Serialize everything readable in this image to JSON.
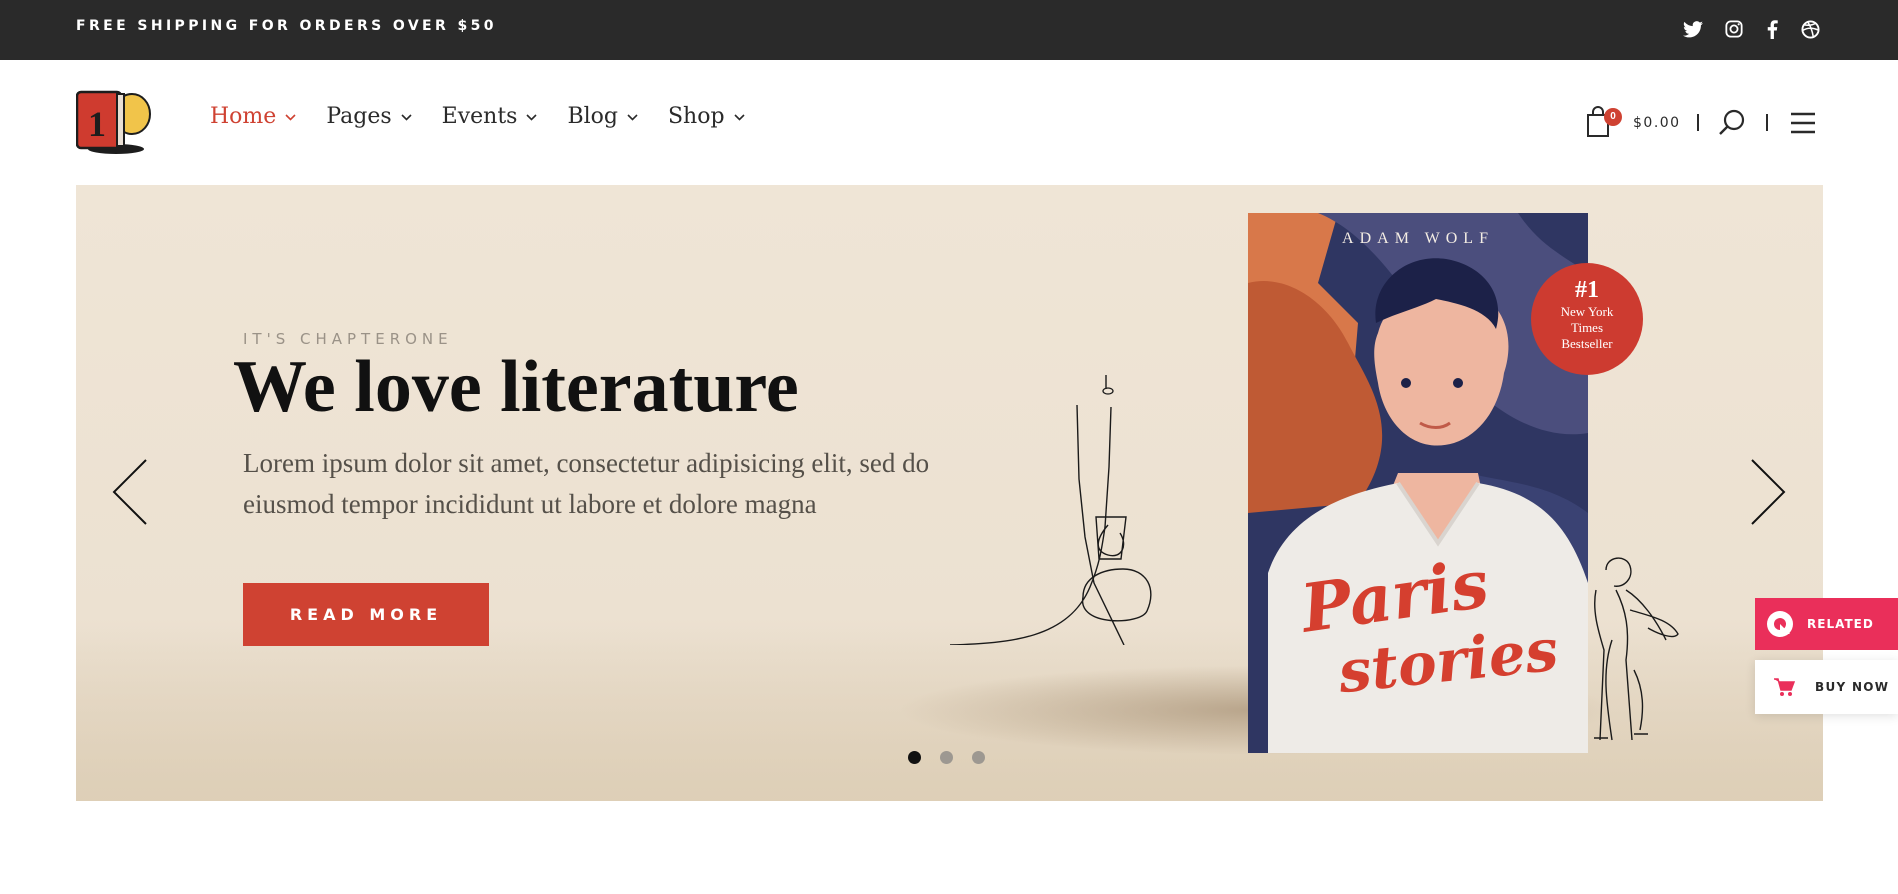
{
  "topbar": {
    "promo_text": "FREE SHIPPING FOR ORDERS OVER $50",
    "social_icons": [
      "twitter-icon",
      "instagram-icon",
      "facebook-icon",
      "dribbble-icon"
    ]
  },
  "header": {
    "logo_text": "1",
    "nav": [
      {
        "label": "Home",
        "active": true
      },
      {
        "label": "Pages",
        "active": false
      },
      {
        "label": "Events",
        "active": false
      },
      {
        "label": "Blog",
        "active": false
      },
      {
        "label": "Shop",
        "active": false
      }
    ],
    "cart_count": "0",
    "cart_total": "$0.00",
    "icons": [
      "shopping-bag-icon",
      "search-icon",
      "hamburger-menu-icon"
    ]
  },
  "hero": {
    "eyebrow": "IT'S CHAPTERONE",
    "headline": "We love literature",
    "subtext": "Lorem ipsum dolor sit amet, consectetur adipisicing elit, sed do eiusmod tempor incididunt ut labore et dolore magna",
    "cta_label": "READ MORE",
    "slides_total": 3,
    "active_slide": 1,
    "book": {
      "author": "ADAM WOLF",
      "title_line1": "Paris",
      "title_line2": "stories",
      "badge_rank": "#1",
      "badge_line1": "New York",
      "badge_line2": "Times",
      "badge_line3": "Bestseller"
    }
  },
  "floating": {
    "related_label": "RELATED",
    "buy_now_label": "BUY NOW"
  },
  "colors": {
    "accent": "#cf4232",
    "topbar_bg": "#2a2a2a",
    "hero_bg": "#efe5d6",
    "related_bg": "#ea2f5a"
  }
}
